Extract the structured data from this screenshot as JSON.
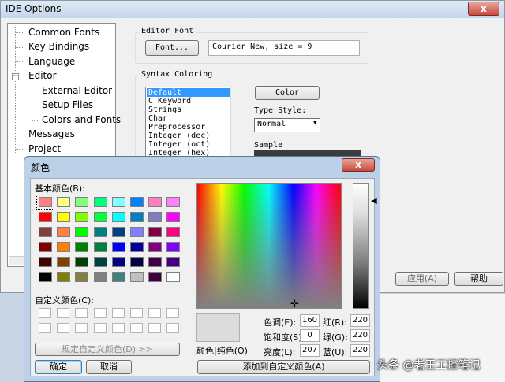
{
  "ide_window": {
    "title": "IDE Options",
    "close_glyph": "x",
    "tree": [
      {
        "label": "Common Fonts"
      },
      {
        "label": "Key Bindings"
      },
      {
        "label": "Language"
      },
      {
        "label": "Editor"
      },
      {
        "label": "External Editor"
      },
      {
        "label": "Setup Files"
      },
      {
        "label": "Colors and Fonts"
      },
      {
        "label": "Messages"
      },
      {
        "label": "Project"
      }
    ],
    "editor_font": {
      "group_title": "Editor Font",
      "font_button": "Font...",
      "font_value": "Courier New, size = 9"
    },
    "syntax_coloring": {
      "group_title": "Syntax Coloring",
      "items": [
        "Default",
        "C Keyword",
        "Strings",
        "Char",
        "Preprocessor",
        "Integer (dec)",
        "Integer (oct)",
        "Integer (hex)"
      ],
      "selected": "Default",
      "color_button": "Color",
      "type_style_label": "Type Style:",
      "type_style_value": "Normal",
      "sample_label": "Sample"
    },
    "bottom_buttons": {
      "apply": "应用(A)",
      "help": "帮助"
    }
  },
  "color_dialog": {
    "title": "颜色",
    "close_glyph": "x",
    "basic_colors_label": "基本颜色(B):",
    "basic_colors": [
      [
        "#ff8080",
        "#ffff80",
        "#80ff80",
        "#00ff80",
        "#80ffff",
        "#0080ff",
        "#ff80c0",
        "#ff80ff"
      ],
      [
        "#ff0000",
        "#ffff00",
        "#80ff00",
        "#00ff40",
        "#00ffff",
        "#0080c0",
        "#8080c0",
        "#ff00ff"
      ],
      [
        "#804040",
        "#ff8040",
        "#00ff00",
        "#008080",
        "#004080",
        "#8080ff",
        "#800040",
        "#ff0080"
      ],
      [
        "#800000",
        "#ff8000",
        "#008000",
        "#008040",
        "#0000ff",
        "#0000a0",
        "#800080",
        "#8000ff"
      ],
      [
        "#400000",
        "#804000",
        "#004000",
        "#004040",
        "#000080",
        "#000040",
        "#400040",
        "#400080"
      ],
      [
        "#000000",
        "#808000",
        "#808040",
        "#808080",
        "#408080",
        "#c0c0c0",
        "#400040",
        "#ffffff"
      ]
    ],
    "custom_colors_label": "自定义颜色(C):",
    "define_custom_button": "规定自定义颜色(D) >>",
    "ok_button": "确定",
    "cancel_button": "取消",
    "color_solid_label": "颜色|纯色(O)",
    "hue_label": "色调(E):",
    "hue_value": "160",
    "sat_label": "饱和度(S):",
    "sat_value": "0",
    "lum_label": "亮度(L):",
    "lum_value": "207",
    "red_label": "红(R):",
    "red_value": "220",
    "green_label": "绿(G):",
    "green_value": "220",
    "blue_label": "蓝(U):",
    "blue_value": "220",
    "add_custom_button": "添加到自定义颜色(A)",
    "current_color": "#dcdcdc",
    "crosshair_glyph": "✛"
  },
  "watermark": "头条 @老王工控笔记"
}
